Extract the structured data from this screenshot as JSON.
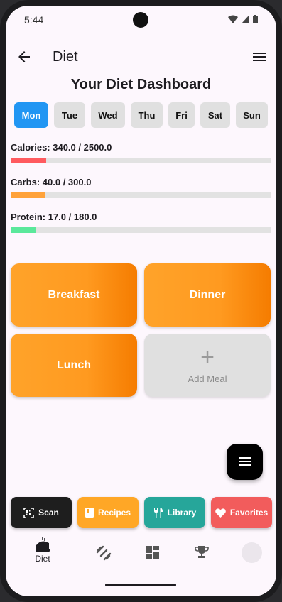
{
  "status": {
    "time": "5:44"
  },
  "appbar": {
    "title": "Diet"
  },
  "page": {
    "title": "Your Diet Dashboard"
  },
  "days": [
    {
      "label": "Mon",
      "active": true
    },
    {
      "label": "Tue",
      "active": false
    },
    {
      "label": "Wed",
      "active": false
    },
    {
      "label": "Thu",
      "active": false
    },
    {
      "label": "Fri",
      "active": false
    },
    {
      "label": "Sat",
      "active": false
    },
    {
      "label": "Sun",
      "active": false
    }
  ],
  "nutrients": [
    {
      "text": "Calories: 340.0 / 2500.0",
      "current": 340.0,
      "goal": 2500.0,
      "color": "#ff5a5f"
    },
    {
      "text": "Carbs: 40.0 / 300.0",
      "current": 40.0,
      "goal": 300.0,
      "color": "#ffa23a"
    },
    {
      "text": "Protein: 17.0 / 180.0",
      "current": 17.0,
      "goal": 180.0,
      "color": "#5be89b"
    }
  ],
  "meals": {
    "breakfast": "Breakfast",
    "dinner": "Dinner",
    "lunch": "Lunch",
    "add_meal": "Add Meal"
  },
  "actions": {
    "scan": {
      "label": "Scan",
      "color": "#1e1e1e",
      "icon": "qr-scan-icon"
    },
    "recipes": {
      "label": "Recipes",
      "color": "#ffa726",
      "icon": "book-icon"
    },
    "library": {
      "label": "Library",
      "color": "#26a69a",
      "icon": "fork-knife-icon"
    },
    "favorites": {
      "label": "Favorites",
      "color": "#f25c5c",
      "icon": "heart-icon"
    }
  },
  "bottom_nav": {
    "diet": "Diet",
    "icons": [
      "diet-icon",
      "dumbbell-icon",
      "dashboard-icon",
      "trophy-icon",
      "avatar"
    ]
  }
}
